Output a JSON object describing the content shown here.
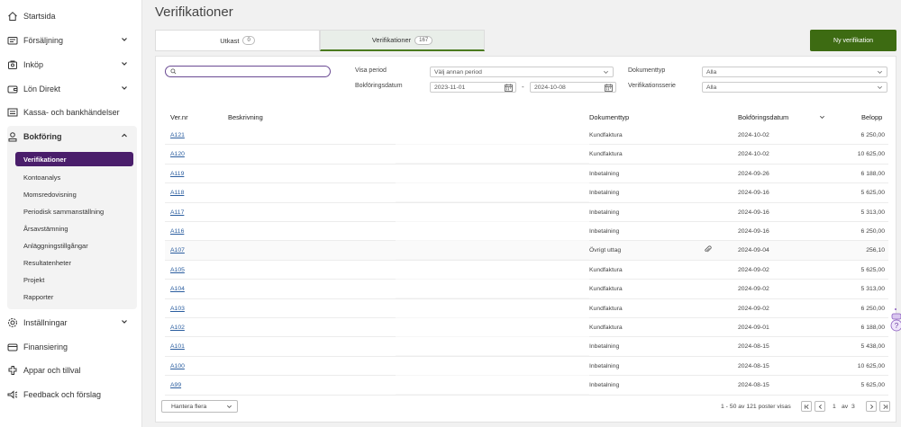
{
  "sidebar": {
    "items": [
      {
        "label": "Startsida",
        "icon": "home-icon",
        "chevron": false
      },
      {
        "label": "Försäljning",
        "icon": "sales-icon",
        "chevron": true
      },
      {
        "label": "Inköp",
        "icon": "purchase-icon",
        "chevron": true
      },
      {
        "label": "Lön Direkt",
        "icon": "wallet-icon",
        "chevron": true
      },
      {
        "label": "Kassa- och bankhändelser",
        "icon": "bank-icon",
        "chevron": false
      },
      {
        "label": "Bokföring",
        "icon": "bookkeeping-icon",
        "chevron": "up"
      },
      {
        "label": "Inställningar",
        "icon": "settings-icon",
        "chevron": true
      },
      {
        "label": "Finansiering",
        "icon": "finance-icon",
        "chevron": false
      },
      {
        "label": "Appar och tillval",
        "icon": "apps-icon",
        "chevron": false
      },
      {
        "label": "Feedback och förslag",
        "icon": "feedback-icon",
        "chevron": false
      }
    ],
    "subitems": [
      "Verifikationer",
      "Kontoanalys",
      "Momsredovisning",
      "Periodisk sammanställning",
      "Årsavstämning",
      "Anläggningstillgångar",
      "Resultatenheter",
      "Projekt",
      "Rapporter"
    ]
  },
  "page": {
    "title": "Verifikationer"
  },
  "tabs": [
    {
      "label": "Utkast",
      "count": "0"
    },
    {
      "label": "Verifikationer",
      "count": "167"
    }
  ],
  "new_button": "Ny verifikation",
  "filters": {
    "search_placeholder": "",
    "period_label": "Visa period",
    "period_value": "Välj annan period",
    "date_label": "Bokföringsdatum",
    "date_from": "2023-11-01",
    "date_sep": "-",
    "date_to": "2024-10-08",
    "doctype_label": "Dokumenttyp",
    "doctype_value": "Alla",
    "series_label": "Verifikationsserie",
    "series_value": "Alla"
  },
  "table": {
    "headers": {
      "vernr": "Ver.nr",
      "desc": "Beskrivning",
      "doctype": "Dokumenttyp",
      "date": "Bokföringsdatum",
      "amount": "Belopp"
    },
    "rows": [
      {
        "vernr": "A121",
        "doctype": "Kundfaktura",
        "date": "2024-10-02",
        "amount": "6 250,00",
        "attach": false
      },
      {
        "vernr": "A120",
        "doctype": "Kundfaktura",
        "date": "2024-10-02",
        "amount": "10 625,00",
        "attach": false
      },
      {
        "vernr": "A119",
        "doctype": "Inbetalning",
        "date": "2024-09-26",
        "amount": "6 188,00",
        "attach": false
      },
      {
        "vernr": "A118",
        "doctype": "Inbetalning",
        "date": "2024-09-16",
        "amount": "5 625,00",
        "attach": false
      },
      {
        "vernr": "A117",
        "doctype": "Inbetalning",
        "date": "2024-09-16",
        "amount": "5 313,00",
        "attach": false
      },
      {
        "vernr": "A116",
        "doctype": "Inbetalning",
        "date": "2024-09-16",
        "amount": "6 250,00",
        "attach": false
      },
      {
        "vernr": "A107",
        "doctype": "Övrigt uttag",
        "date": "2024-09-04",
        "amount": "256,10",
        "attach": true
      },
      {
        "vernr": "A105",
        "doctype": "Kundfaktura",
        "date": "2024-09-02",
        "amount": "5 625,00",
        "attach": false
      },
      {
        "vernr": "A104",
        "doctype": "Kundfaktura",
        "date": "2024-09-02",
        "amount": "5 313,00",
        "attach": false
      },
      {
        "vernr": "A103",
        "doctype": "Kundfaktura",
        "date": "2024-09-02",
        "amount": "6 250,00",
        "attach": false
      },
      {
        "vernr": "A102",
        "doctype": "Kundfaktura",
        "date": "2024-09-01",
        "amount": "6 188,00",
        "attach": false
      },
      {
        "vernr": "A101",
        "doctype": "Inbetalning",
        "date": "2024-08-15",
        "amount": "5 438,00",
        "attach": false
      },
      {
        "vernr": "A100",
        "doctype": "Inbetalning",
        "date": "2024-08-15",
        "amount": "10 625,00",
        "attach": false
      },
      {
        "vernr": "A99",
        "doctype": "Inbetalning",
        "date": "2024-08-15",
        "amount": "5 625,00",
        "attach": false
      }
    ]
  },
  "footer": {
    "bulk_label": "Hantera flera",
    "range_text": "1 - 50 av 121 poster visas",
    "page_current": "1",
    "page_of": "av",
    "page_total": "3"
  },
  "colors": {
    "accent": "#4a1e6b",
    "primary_button": "#3d6b12",
    "link": "#2a5d9f"
  }
}
